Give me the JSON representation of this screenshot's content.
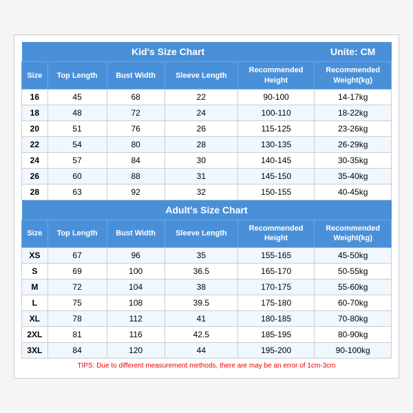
{
  "kids_chart": {
    "title": "Kid's Size Chart",
    "unit": "Unite: CM",
    "columns": [
      "Size",
      "Top Length",
      "Bust Width",
      "Sleeve Length",
      "Recommended\nHeight",
      "Recommended\nWeight(kg)"
    ],
    "rows": [
      [
        "16",
        "45",
        "68",
        "22",
        "90-100",
        "14-17kg"
      ],
      [
        "18",
        "48",
        "72",
        "24",
        "100-110",
        "18-22kg"
      ],
      [
        "20",
        "51",
        "76",
        "26",
        "115-125",
        "23-26kg"
      ],
      [
        "22",
        "54",
        "80",
        "28",
        "130-135",
        "26-29kg"
      ],
      [
        "24",
        "57",
        "84",
        "30",
        "140-145",
        "30-35kg"
      ],
      [
        "26",
        "60",
        "88",
        "31",
        "145-150",
        "35-40kg"
      ],
      [
        "28",
        "63",
        "92",
        "32",
        "150-155",
        "40-45kg"
      ]
    ]
  },
  "adults_chart": {
    "title": "Adult's Size Chart",
    "columns": [
      "Size",
      "Top Length",
      "Bust Width",
      "Sleeve Length",
      "Recommended\nHeight",
      "Recommended\nWeight(kg)"
    ],
    "rows": [
      [
        "XS",
        "67",
        "96",
        "35",
        "155-165",
        "45-50kg"
      ],
      [
        "S",
        "69",
        "100",
        "36.5",
        "165-170",
        "50-55kg"
      ],
      [
        "M",
        "72",
        "104",
        "38",
        "170-175",
        "55-60kg"
      ],
      [
        "L",
        "75",
        "108",
        "39.5",
        "175-180",
        "60-70kg"
      ],
      [
        "XL",
        "78",
        "112",
        "41",
        "180-185",
        "70-80kg"
      ],
      [
        "2XL",
        "81",
        "116",
        "42.5",
        "185-195",
        "80-90kg"
      ],
      [
        "3XL",
        "84",
        "120",
        "44",
        "195-200",
        "90-100kg"
      ]
    ]
  },
  "tips": "TIPS: Due to different measurement methods, there are may be an error of 1cm-3cm"
}
